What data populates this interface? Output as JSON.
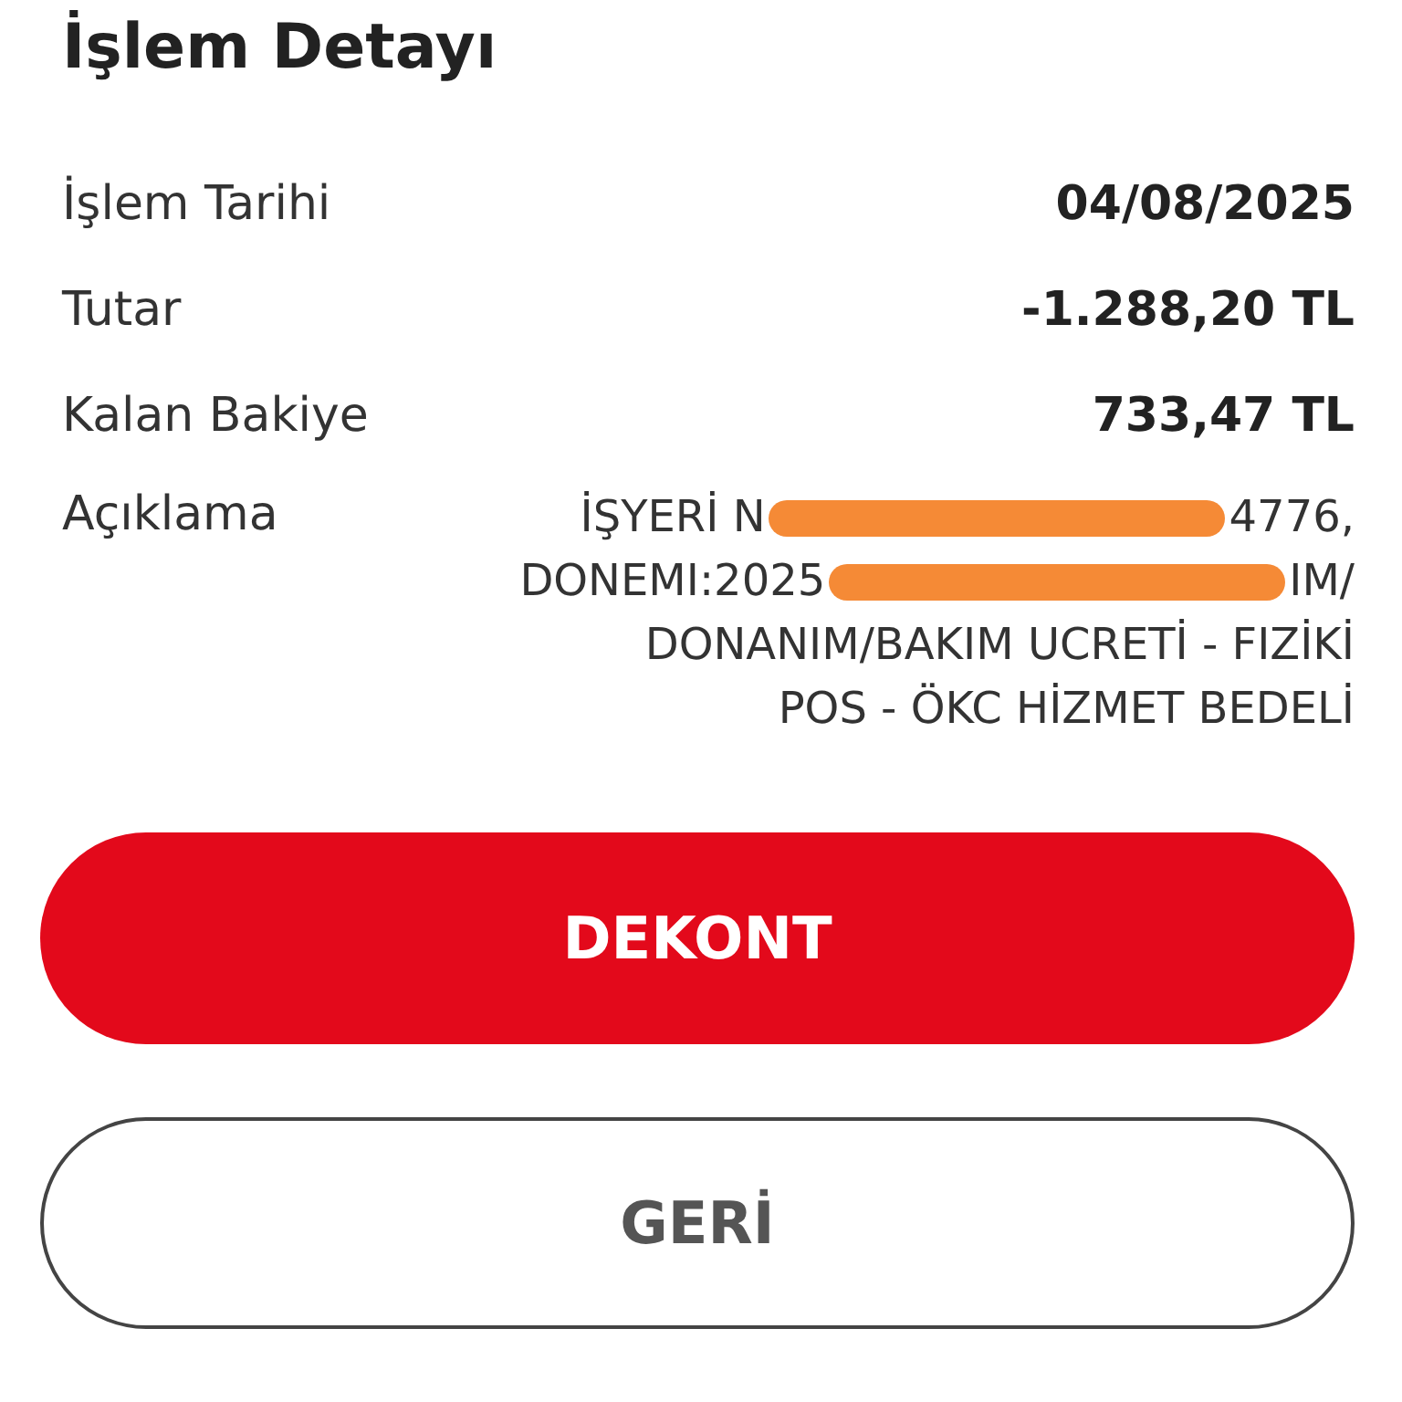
{
  "title": "İşlem Detayı",
  "details": [
    {
      "label": "İşlem Tarihi",
      "value": "04/08/2025"
    },
    {
      "label": "Tutar",
      "value": "-1.288,20 TL"
    },
    {
      "label": "Kalan Bakiye",
      "value": "733,47 TL"
    }
  ],
  "description": {
    "label": "Açıklama",
    "lines": [
      [
        {
          "kind": "text",
          "text": "İŞYERİ N"
        },
        {
          "kind": "redaction"
        },
        {
          "kind": "text",
          "text": "4776,"
        }
      ],
      [
        {
          "kind": "text",
          "text": "DONEMI:2025"
        },
        {
          "kind": "redaction"
        },
        {
          "kind": "text",
          "text": "IM/"
        }
      ],
      [
        {
          "kind": "text",
          "text": "DONANIM/BAKIM UCRETİ - FIZİKİ"
        }
      ],
      [
        {
          "kind": "text",
          "text": "POS - ÖKC HİZMET BEDELİ"
        }
      ]
    ]
  },
  "buttons": [
    {
      "label": "DEKONT",
      "kind": "primary"
    },
    {
      "label": "GERİ",
      "kind": "secondary"
    }
  ]
}
